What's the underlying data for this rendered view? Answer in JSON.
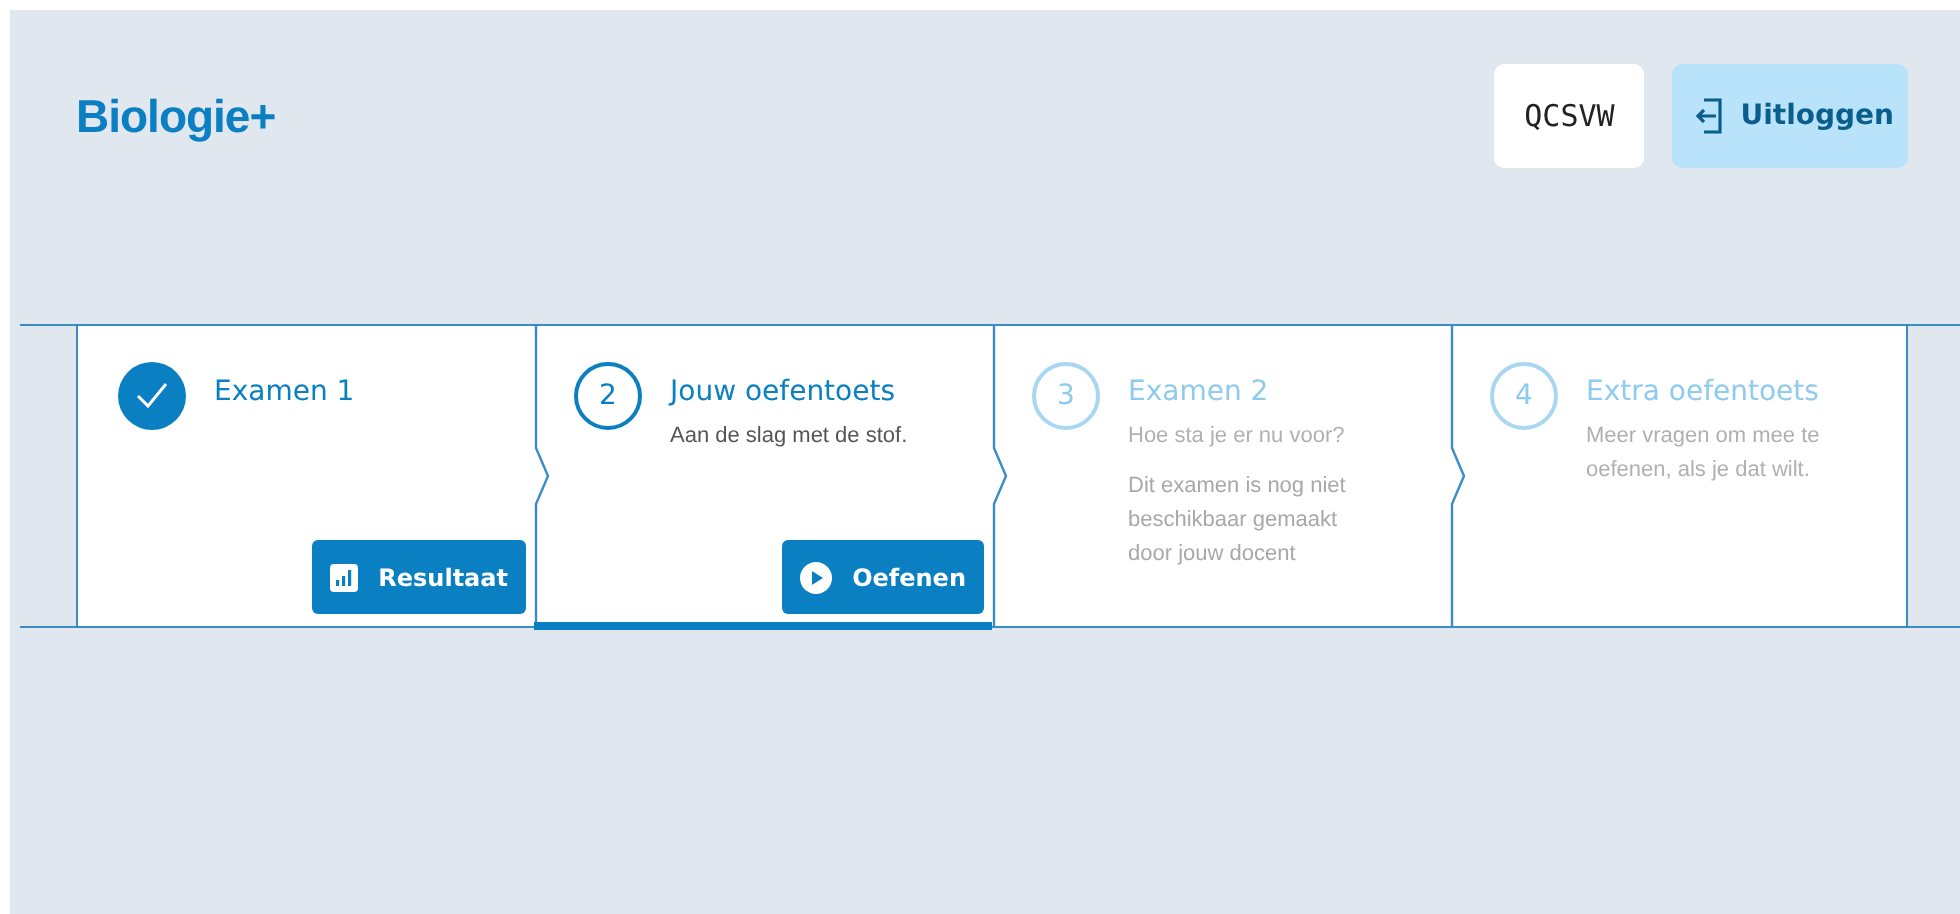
{
  "header": {
    "logo": "Biologie+",
    "code": "QCSVW",
    "logout_button": "Uitloggen"
  },
  "steps": [
    {
      "kind": "done",
      "title": "Examen 1",
      "selected": false,
      "disabled": false,
      "button": {
        "label": "Resultaat"
      }
    },
    {
      "kind": "number",
      "marker": "2",
      "title": "Jouw oefentoets",
      "selected": true,
      "disabled": false,
      "description": [
        "Aan de slag met de stof."
      ],
      "button": {
        "label": "Oefenen"
      }
    },
    {
      "kind": "number",
      "marker": "3",
      "title": "Examen 2",
      "selected": false,
      "disabled": true,
      "description": [
        "Hoe sta je er nu voor?",
        "Dit examen is nog niet beschikbaar gemaakt door jouw docent"
      ]
    },
    {
      "kind": "number",
      "marker": "4",
      "title": "Extra oefentoets",
      "selected": false,
      "disabled": true,
      "description": [
        "Meer vragen om mee te oefenen, als je dat wilt."
      ]
    }
  ]
}
